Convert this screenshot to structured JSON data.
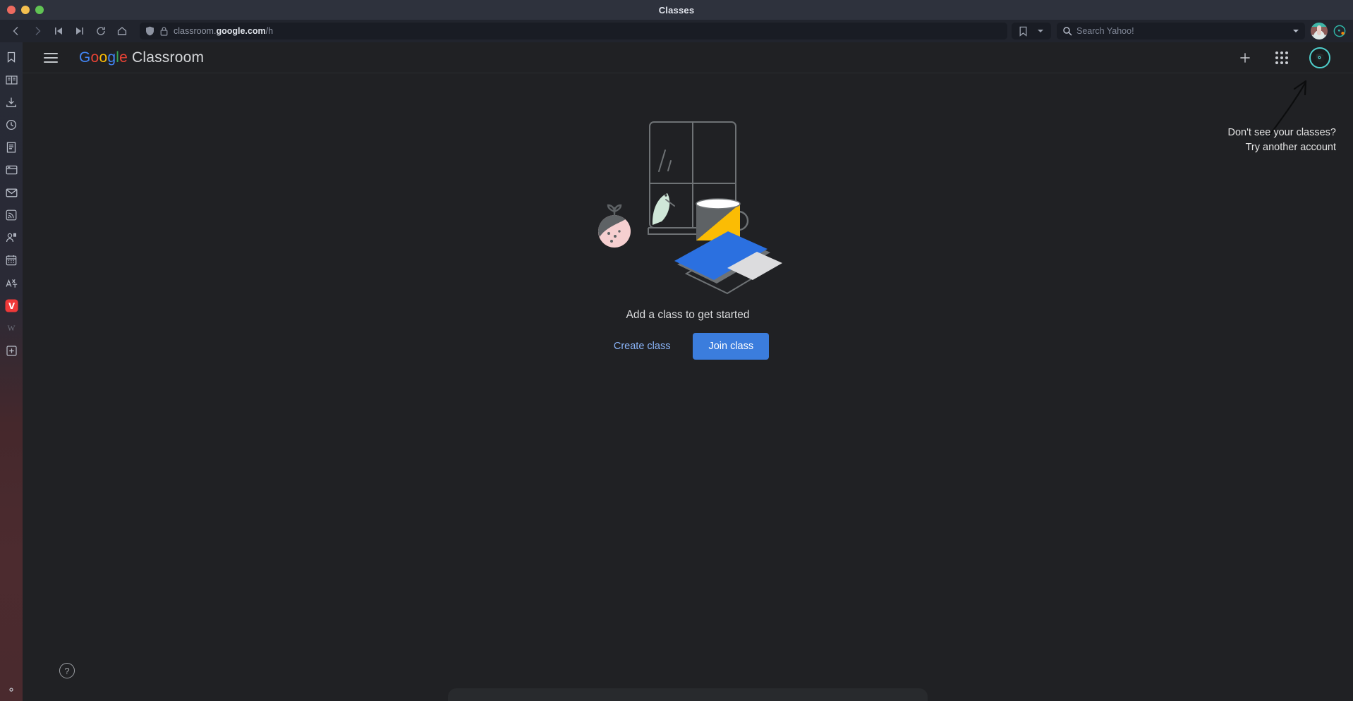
{
  "window": {
    "title": "Classes",
    "traffic_lights": [
      "close",
      "minimize",
      "maximize"
    ]
  },
  "browser": {
    "nav": [
      {
        "name": "back-button",
        "icon": "chevron-left-icon"
      },
      {
        "name": "forward-button",
        "icon": "chevron-right-icon"
      },
      {
        "name": "rewind-button",
        "icon": "skip-back-icon"
      },
      {
        "name": "fast-forward-button",
        "icon": "skip-forward-icon"
      },
      {
        "name": "reload-button",
        "icon": "reload-icon"
      },
      {
        "name": "home-button",
        "icon": "home-icon"
      }
    ],
    "address": {
      "shield_icon": "shield-icon",
      "lock_icon": "lock-icon",
      "prefix": "classroom.",
      "domain": "google.com",
      "suffix": "/h",
      "full_url": "classroom.google.com/h"
    },
    "bookmark_icon": "bookmark-icon",
    "bookmark_dropdown_icon": "chevron-down-icon",
    "search": {
      "icon": "search-icon",
      "placeholder": "Search Yahoo!",
      "value": "",
      "dropdown_icon": "chevron-down-icon"
    },
    "profile_icon": "browser-profile-avatar",
    "vivaldi_icon": "vivaldi-logo-icon"
  },
  "panel": {
    "items": [
      {
        "name": "panel-bookmarks",
        "icon": "bookmark-icon"
      },
      {
        "name": "panel-reading-list",
        "icon": "book-icon"
      },
      {
        "name": "panel-downloads",
        "icon": "download-icon"
      },
      {
        "name": "panel-history",
        "icon": "clock-icon"
      },
      {
        "name": "panel-notes",
        "icon": "notes-icon"
      },
      {
        "name": "panel-window",
        "icon": "window-panel-icon"
      },
      {
        "name": "panel-mail",
        "icon": "mail-icon"
      },
      {
        "name": "panel-feeds",
        "icon": "rss-icon"
      },
      {
        "name": "panel-contacts",
        "icon": "contacts-icon"
      },
      {
        "name": "panel-calendar",
        "icon": "calendar-icon"
      },
      {
        "name": "panel-translate",
        "icon": "translate-icon"
      },
      {
        "name": "panel-vivaldi",
        "icon": "vivaldi-logo-icon"
      },
      {
        "name": "panel-wikipedia",
        "icon": "wikipedia-w-icon"
      },
      {
        "name": "panel-add",
        "icon": "plus-square-icon"
      }
    ],
    "settings_icon": "gear-icon"
  },
  "classroom": {
    "menu_icon": "hamburger-menu-icon",
    "brand": {
      "google": [
        "G",
        "o",
        "o",
        "g",
        "l",
        "e"
      ],
      "product": "Classroom"
    },
    "header_actions": [
      {
        "name": "add-button",
        "icon": "plus-icon",
        "label": "+"
      },
      {
        "name": "google-apps-button",
        "icon": "apps-grid-icon"
      },
      {
        "name": "account-avatar",
        "icon": "account-avatar-icon"
      }
    ],
    "hint": {
      "line1": "Don't see your classes?",
      "line2": "Try another account",
      "arrow_icon": "curved-arrow-up-icon"
    },
    "empty_state": {
      "illustration": "window-desk-illustration",
      "title": "Add a class to get started",
      "create_label": "Create class",
      "join_label": "Join class"
    },
    "help_icon": "question-mark-icon",
    "help_label": "?"
  },
  "colors": {
    "accent_blue": "#3b7ddd",
    "link_blue": "#8ab4f8",
    "page_bg": "#202124",
    "toolbar_bg": "#21242d",
    "titlebar_bg": "#2e323d",
    "avatar_ring": "#4fd0cd",
    "illustration_blue": "#2b70e0",
    "illustration_yellow": "#fbbc04",
    "illustration_green": "#cfe7d8",
    "illustration_pink": "#f6cfd0"
  }
}
